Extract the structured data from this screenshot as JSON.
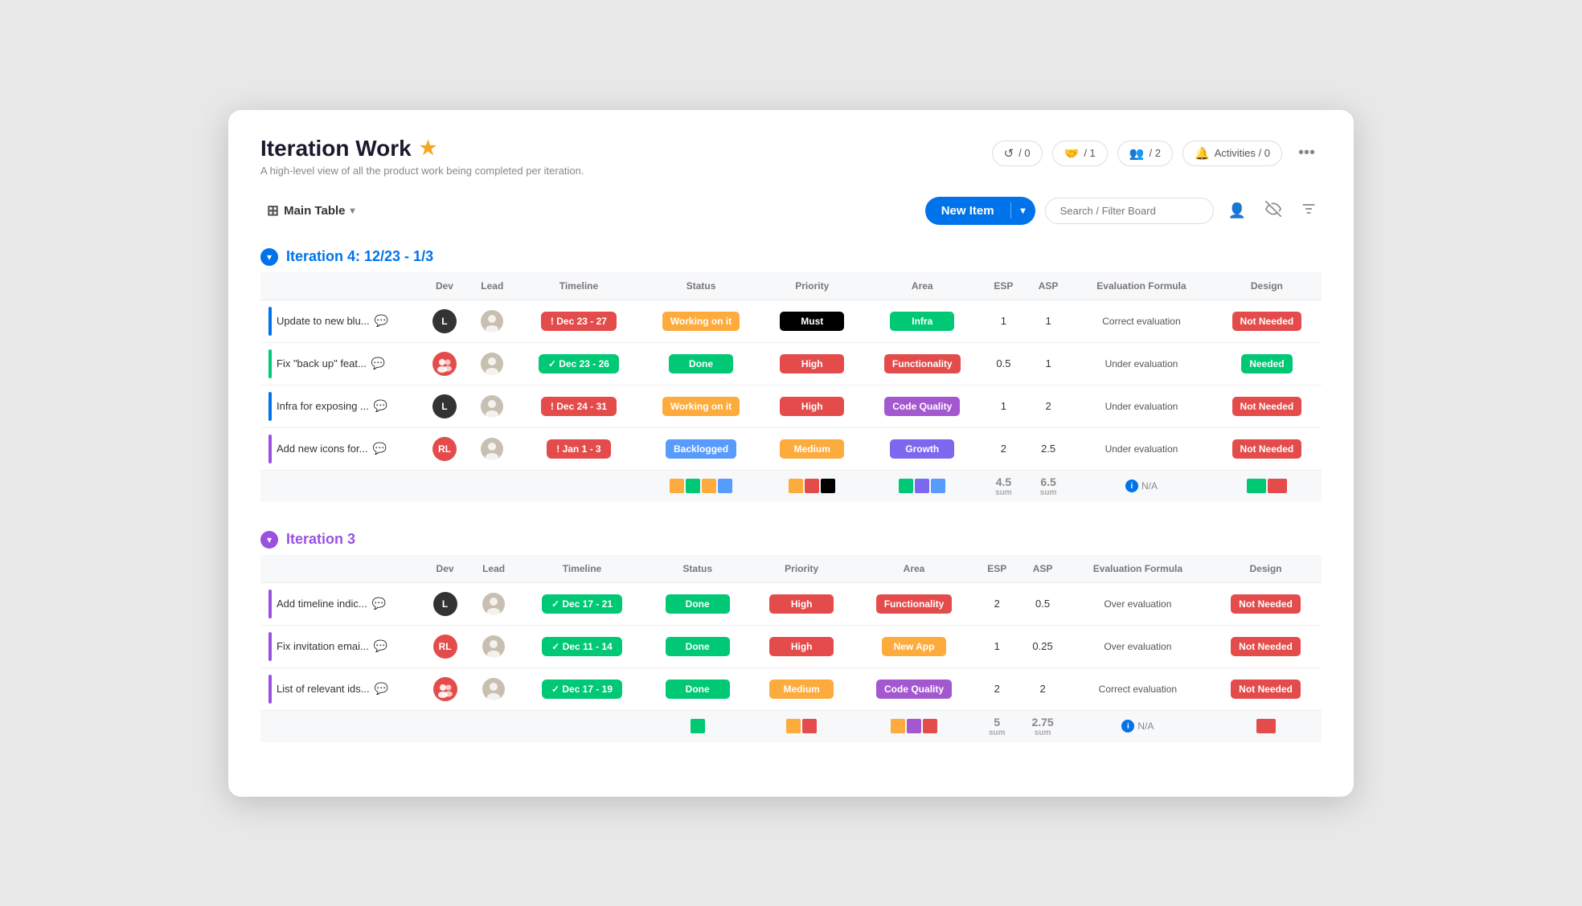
{
  "app": {
    "title": "Iteration Work",
    "subtitle": "A high-level view of all the product work being completed per iteration.",
    "star": "★"
  },
  "header_badges": [
    {
      "icon": "↺",
      "label": "/ 0"
    },
    {
      "icon": "🤝",
      "label": "/ 1"
    },
    {
      "icon": "👥",
      "label": "/ 2"
    }
  ],
  "activities_label": "Activities / 0",
  "toolbar": {
    "table_icon": "⊞",
    "main_table_label": "Main Table",
    "chevron": "▾",
    "new_item_label": "New Item",
    "new_item_arrow": "▾",
    "search_placeholder": "Search / Filter Board",
    "profile_icon": "👤",
    "eye_off_icon": "👁",
    "filter_icon": "≡"
  },
  "iteration4": {
    "title": "Iteration 4: 12/23 - 1/3",
    "color": "#0073ea",
    "toggle_color": "#0073ea",
    "columns": [
      "Dev",
      "Lead",
      "Timeline",
      "Status",
      "Priority",
      "Area",
      "ESP",
      "ASP",
      "Evaluation Formula",
      "Design"
    ],
    "rows": [
      {
        "bar_color": "#0073ea",
        "name": "Update to new blu...",
        "dev_label": "L",
        "dev_color": "#333",
        "lead_type": "photo",
        "timeline_text": "! Dec 23 - 27",
        "timeline_type": "exclamation",
        "status_text": "Working on it",
        "status_color": "#fdab3d",
        "priority_text": "Must",
        "priority_color": "#000000",
        "area_text": "Infra",
        "area_color": "#00c875",
        "esp": "1",
        "asp": "1",
        "eval_text": "Correct evaluation",
        "design_text": "Not Needed",
        "design_color": "#e44c4c"
      },
      {
        "bar_color": "#00c875",
        "name": "Fix \"back up\" feat...",
        "dev_label": "👥",
        "dev_color": "#e44c4c",
        "lead_type": "photo",
        "timeline_text": "✓ Dec 23 - 26",
        "timeline_type": "check",
        "status_text": "Done",
        "status_color": "#00c875",
        "priority_text": "High",
        "priority_color": "#e44c4c",
        "area_text": "Functionality",
        "area_color": "#e44c4c",
        "esp": "0.5",
        "asp": "1",
        "eval_text": "Under evaluation",
        "design_text": "Needed",
        "design_color": "#00c875"
      },
      {
        "bar_color": "#0073ea",
        "name": "Infra for exposing ...",
        "dev_label": "L",
        "dev_color": "#333",
        "lead_type": "photo",
        "timeline_text": "! Dec 24 - 31",
        "timeline_type": "exclamation",
        "status_text": "Working on it",
        "status_color": "#fdab3d",
        "priority_text": "High",
        "priority_color": "#e44c4c",
        "area_text": "Code Quality",
        "area_color": "#a358d0",
        "esp": "1",
        "asp": "2",
        "eval_text": "Under evaluation",
        "design_text": "Not Needed",
        "design_color": "#e44c4c"
      },
      {
        "bar_color": "#9b51e0",
        "name": "Add new icons for...",
        "dev_label": "RL",
        "dev_color": "#e44c4c",
        "lead_type": "photo",
        "timeline_text": "! Jan 1 - 3",
        "timeline_type": "exclamation",
        "status_text": "Backlogged",
        "status_color": "#579bfc",
        "priority_text": "Medium",
        "priority_color": "#fdab3d",
        "area_text": "Growth",
        "area_color": "#7b68ee",
        "esp": "2",
        "asp": "2.5",
        "eval_text": "Under evaluation",
        "design_text": "Not Needed",
        "design_color": "#e44c4c"
      }
    ],
    "sum_row": {
      "esp_sum": "4.5",
      "asp_sum": "6.5",
      "na_label": "N/A",
      "status_swatches": [
        "#fdab3d",
        "#00c875",
        "#fdab3d",
        "#579bfc"
      ],
      "priority_swatches": [
        "#fdab3d",
        "#e44c4c",
        "#000000"
      ],
      "area_swatches": [
        "#00c875",
        "#7b68ee",
        "#579bfc"
      ],
      "design_swatches": [
        "#00c875",
        "#e44c4c"
      ]
    }
  },
  "iteration3": {
    "title": "Iteration 3",
    "color": "#9b51e0",
    "toggle_color": "#9b51e0",
    "columns": [
      "Dev",
      "Lead",
      "Timeline",
      "Status",
      "Priority",
      "Area",
      "ESP",
      "ASP",
      "Evaluation Formula",
      "Design"
    ],
    "rows": [
      {
        "bar_color": "#9b51e0",
        "name": "Add timeline indic...",
        "dev_label": "L",
        "dev_color": "#333",
        "lead_type": "photo",
        "timeline_text": "✓ Dec 17 - 21",
        "timeline_type": "check",
        "status_text": "Done",
        "status_color": "#00c875",
        "priority_text": "High",
        "priority_color": "#e44c4c",
        "area_text": "Functionality",
        "area_color": "#e44c4c",
        "esp": "2",
        "asp": "0.5",
        "eval_text": "Over evaluation",
        "design_text": "Not Needed",
        "design_color": "#e44c4c"
      },
      {
        "bar_color": "#9b51e0",
        "name": "Fix invitation emai...",
        "dev_label": "RL",
        "dev_color": "#e44c4c",
        "lead_type": "photo",
        "timeline_text": "✓ Dec 11 - 14",
        "timeline_type": "check",
        "status_text": "Done",
        "status_color": "#00c875",
        "priority_text": "High",
        "priority_color": "#e44c4c",
        "area_text": "New App",
        "area_color": "#fdab3d",
        "esp": "1",
        "asp": "0.25",
        "eval_text": "Over evaluation",
        "design_text": "Not Needed",
        "design_color": "#e44c4c"
      },
      {
        "bar_color": "#9b51e0",
        "name": "List of relevant ids...",
        "dev_label": "👥",
        "dev_color": "#e44c4c",
        "lead_type": "photo",
        "timeline_text": "✓ Dec 17 - 19",
        "timeline_type": "check",
        "status_text": "Done",
        "status_color": "#00c875",
        "priority_text": "Medium",
        "priority_color": "#fdab3d",
        "area_text": "Code Quality",
        "area_color": "#a358d0",
        "esp": "2",
        "asp": "2",
        "eval_text": "Correct evaluation",
        "design_text": "Not Needed",
        "design_color": "#e44c4c"
      }
    ],
    "sum_row": {
      "esp_sum": "5",
      "asp_sum": "2.75",
      "na_label": "N/A",
      "status_swatches": [
        "#00c875"
      ],
      "priority_swatches": [
        "#fdab3d",
        "#e44c4c"
      ],
      "area_swatches": [
        "#fdab3d",
        "#a358d0",
        "#e44c4c"
      ],
      "design_swatches": [
        "#e44c4c"
      ]
    }
  }
}
